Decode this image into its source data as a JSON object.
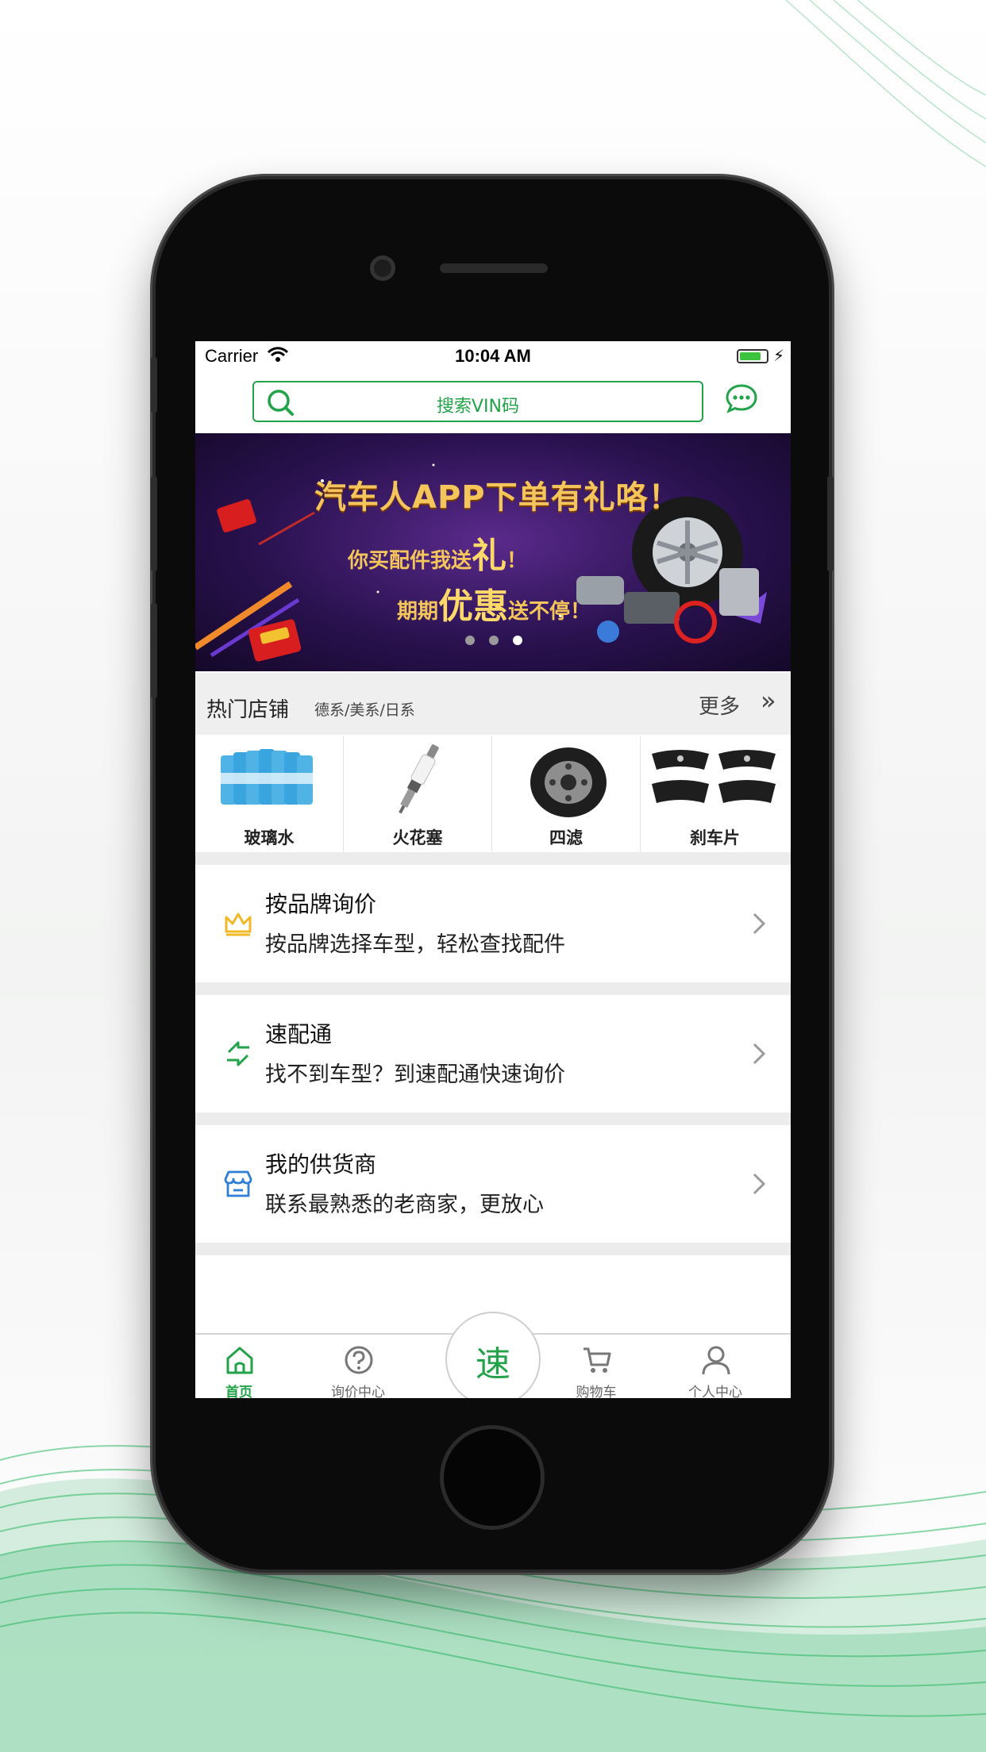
{
  "status_bar": {
    "carrier": "Carrier",
    "time": "10:04 AM"
  },
  "search": {
    "placeholder": "搜索VIN码"
  },
  "banner": {
    "line1": "汽车人APP下单有礼咯！",
    "line2_prefix": "你买配件我送",
    "line2_big": "礼",
    "line2_suffix": "！",
    "line3_prefix": "期期",
    "line3_big": "优惠",
    "line3_suffix": "送不停！",
    "slide_count": 3,
    "active_slide": 3
  },
  "hot_shops": {
    "title": "热门店铺",
    "subtitle": "德系/美系/日系",
    "more": "更多",
    "more_icon": "double-chevron-right-icon",
    "products": [
      {
        "label": "玻璃水",
        "icon": "washer-fluid-bottles"
      },
      {
        "label": "火花塞",
        "icon": "spark-plug"
      },
      {
        "label": "四滤",
        "icon": "oil-filter"
      },
      {
        "label": "刹车片",
        "icon": "brake-pads"
      }
    ]
  },
  "menu": [
    {
      "title": "按品牌询价",
      "desc": "按品牌选择车型，轻松查找配件",
      "icon": "crown-icon",
      "icon_color": "#f2b824"
    },
    {
      "title": "速配通",
      "desc": "找不到车型？到速配通快速询价",
      "icon": "exchange-arrows-icon",
      "icon_color": "#22a349"
    },
    {
      "title": "我的供货商",
      "desc": "联系最熟悉的老商家，更放心",
      "icon": "store-icon",
      "icon_color": "#2e7fd6"
    }
  ],
  "tabbar": {
    "tabs": [
      {
        "label": "首页",
        "icon": "home-icon",
        "active": true
      },
      {
        "label": "询价中心",
        "icon": "question-circle-icon",
        "active": false
      },
      {
        "label": "购物车",
        "icon": "cart-icon",
        "active": false
      },
      {
        "label": "个人中心",
        "icon": "user-icon",
        "active": false
      }
    ],
    "center_label": "速"
  },
  "colors": {
    "accent": "#22a349",
    "banner_text": "#f4c55a",
    "banner_bg": "#2a1250"
  }
}
